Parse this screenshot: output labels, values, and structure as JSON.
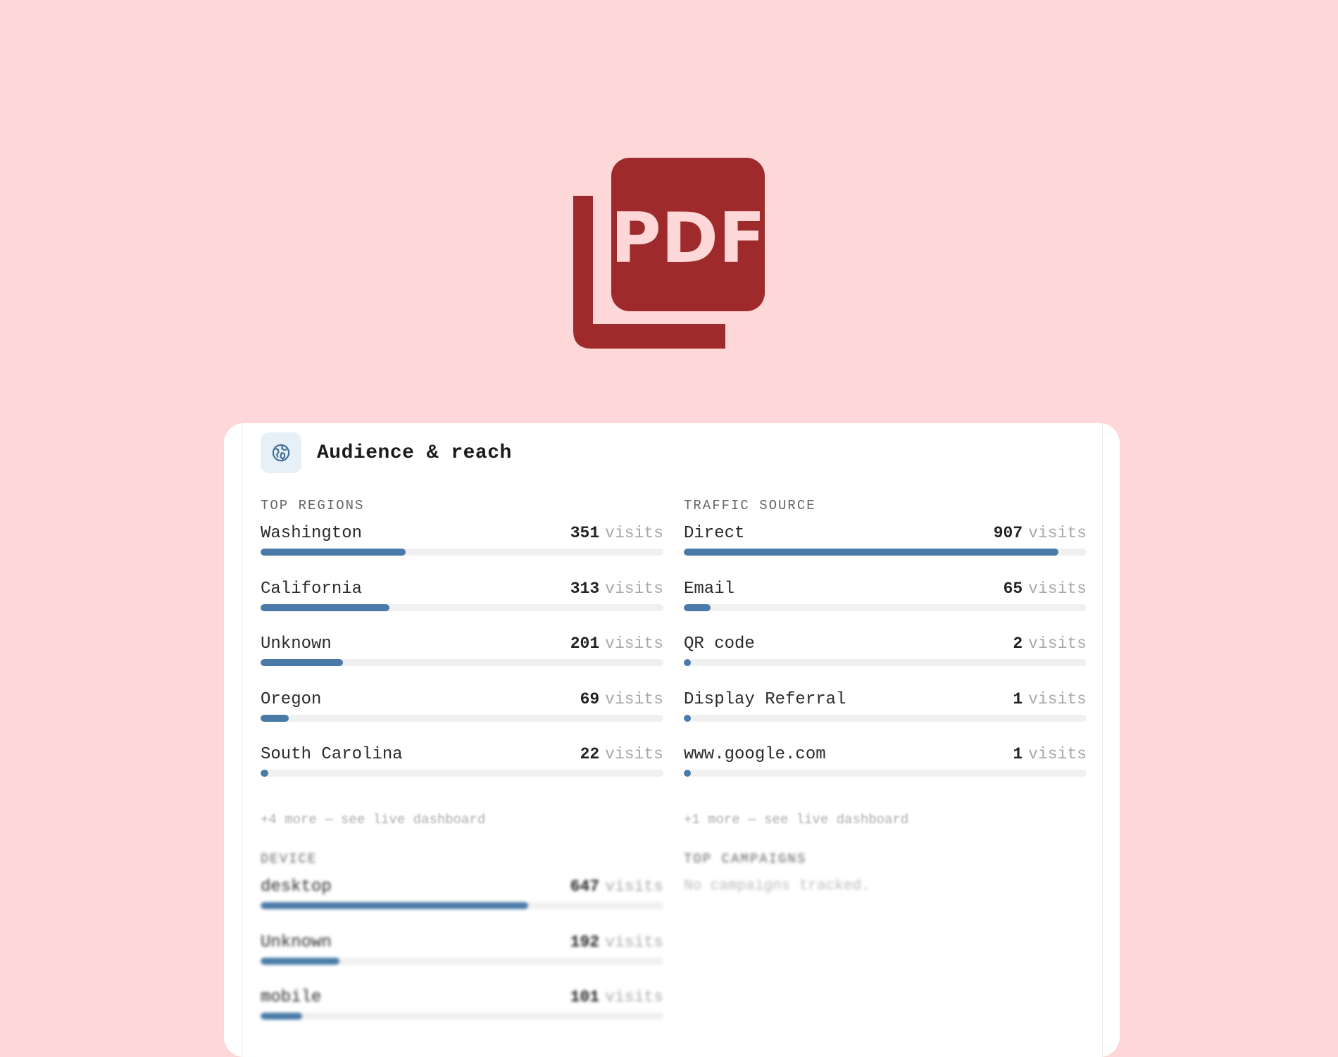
{
  "pdf_badge": {
    "text": "PDF",
    "color": "#9E2A2B",
    "icon": "pdf-file-icon"
  },
  "card": {
    "title": "Audience & reach",
    "icon": "globe-icon",
    "accent": "#4A7BA8"
  },
  "top_regions": {
    "label": "TOP REGIONS",
    "items": [
      {
        "name": "Washington",
        "value": "351",
        "unit": "visits",
        "share": 0.36
      },
      {
        "name": "California",
        "value": "313",
        "unit": "visits",
        "share": 0.32
      },
      {
        "name": "Unknown",
        "value": "201",
        "unit": "visits",
        "share": 0.205
      },
      {
        "name": "Oregon",
        "value": "69",
        "unit": "visits",
        "share": 0.07
      },
      {
        "name": "South Carolina",
        "value": "22",
        "unit": "visits",
        "share": 0.02
      }
    ],
    "more": "+4 more — see live dashboard"
  },
  "traffic_source": {
    "label": "TRAFFIC SOURCE",
    "items": [
      {
        "name": "Direct",
        "value": "907",
        "unit": "visits",
        "share": 0.93
      },
      {
        "name": "Email",
        "value": "65",
        "unit": "visits",
        "share": 0.067
      },
      {
        "name": "QR code",
        "value": "2",
        "unit": "visits",
        "share": 0.002
      },
      {
        "name": "Display Referral",
        "value": "1",
        "unit": "visits",
        "share": 0.001
      },
      {
        "name": "www.google.com",
        "value": "1",
        "unit": "visits",
        "share": 0.001
      }
    ],
    "more": "+1 more — see live dashboard"
  },
  "device": {
    "label": "DEVICE",
    "items": [
      {
        "name": "desktop",
        "value": "647",
        "unit": "visits",
        "share": 0.665
      },
      {
        "name": "Unknown",
        "value": "192",
        "unit": "visits",
        "share": 0.195
      },
      {
        "name": "mobile",
        "value": "101",
        "unit": "visits",
        "share": 0.104
      }
    ]
  },
  "top_campaigns": {
    "label": "TOP CAMPAIGNS",
    "empty": "No campaigns tracked."
  }
}
